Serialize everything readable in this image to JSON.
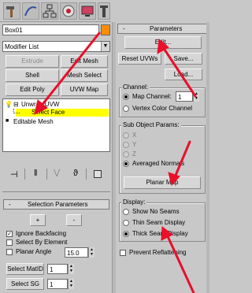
{
  "toolbar": {
    "icons": [
      "modify-hammer-icon",
      "curve-icon",
      "hierarchy-icon",
      "motion-icon",
      "display-icon",
      "utilities-icon"
    ]
  },
  "object_name": "Box01",
  "object_color": "#ff8c00",
  "modifier_list": "Modifier List",
  "quick_buttons": {
    "extrude": "Extrude",
    "edit_mesh": "Edit Mesh",
    "shell": "Shell",
    "mesh_select": "Mesh Select",
    "edit_poly": "Edit Poly",
    "uvw_map": "UVW Map"
  },
  "stack": {
    "items": [
      {
        "label": "Unwrap UVW",
        "symbol": "⊟"
      },
      {
        "label": "Select Face",
        "symbol": ""
      },
      {
        "label": "Editable Mesh",
        "symbol": "■"
      }
    ]
  },
  "stack_tools": [
    "pin-stack-icon",
    "show-end-result-icon",
    "make-unique-icon",
    "remove-modifier-icon",
    "configure-sets-icon"
  ],
  "selection_params": {
    "header_symbol": "-",
    "title": "Selection Parameters",
    "plus": "+",
    "minus": "-",
    "ignore_backfacing": "Ignore Backfacing",
    "select_by_element": "Select By Element",
    "planar_angle": "Planar Angle",
    "planar_angle_value": "15.0",
    "select_matid": "Select MatID",
    "matid_value": "1",
    "select_sg": "Select SG",
    "sg_value": "1"
  },
  "parameters": {
    "header_symbol": "-",
    "title": "Parameters",
    "edit": "Edit...",
    "reset_uvws": "Reset UVWs",
    "save": "Save...",
    "load": "Load...",
    "channel_label": "Channel:",
    "map_channel": "Map Channel:",
    "map_channel_value": "1",
    "vertex_color_channel": "Vertex Color Channel",
    "sub_object_label": "Sub Object Params:",
    "axis_x": "X",
    "axis_y": "Y",
    "axis_z": "Z",
    "averaged_normals": "Averaged Normals",
    "planar_map": "Planar Map",
    "display_label": "Display:",
    "show_no_seams": "Show No Seams",
    "thin_seam_display": "Thin Seam Display",
    "thick_seam_display": "Thick Seam Display",
    "prevent_reflattening": "Prevent Reflattening"
  },
  "colors": {
    "panel": "#c8c8c8",
    "selected_row": "#ffff00",
    "annotation_arrow": "#e8102a"
  }
}
